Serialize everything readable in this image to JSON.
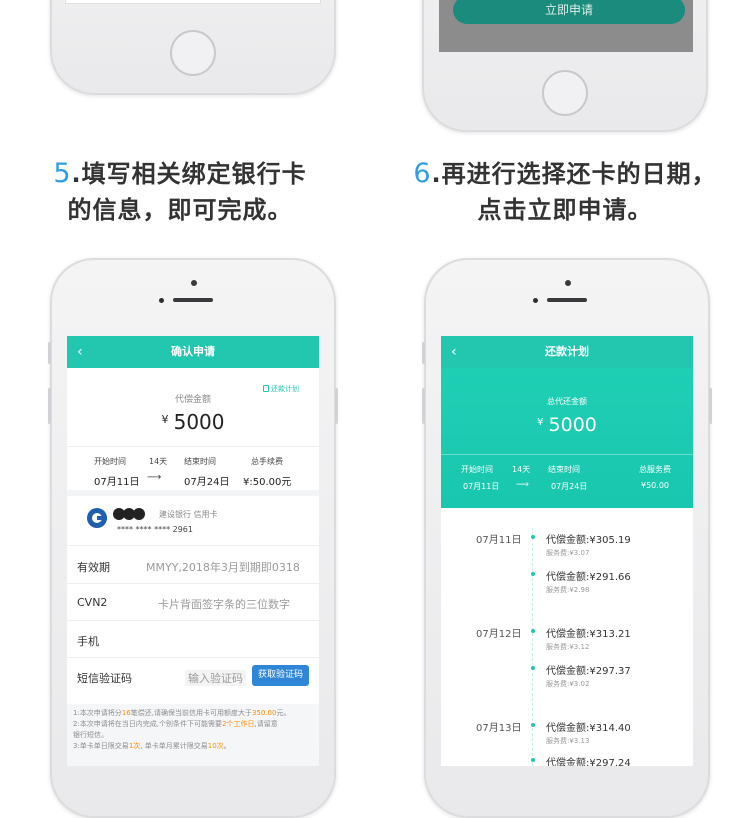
{
  "top_right_screen": {
    "apply_button": "立即申请"
  },
  "captions": {
    "left": {
      "num": "5",
      "line1": ".填写相关绑定银行卡",
      "line2": "的信息，即可完成。"
    },
    "right": {
      "num": "6",
      "line1": ".再进行选择还卡的日期，",
      "line2": "点击立即申请。"
    }
  },
  "confirm_screen": {
    "back_icon": "‹",
    "title": "确认申请",
    "plan_link": "还款计划",
    "amount_label": "代偿金额",
    "currency": "¥",
    "amount": "5000",
    "start_label": "开始时间",
    "start_date": "07月11日",
    "days": "14天",
    "arrow": "⟶",
    "end_label": "结束时间",
    "end_date": "07月24日",
    "fee_label": "总手续费",
    "fee_value": "¥:50.00元",
    "bank_name": "建设银行  信用卡",
    "card_mask": "**** **** ****  2961",
    "fields": [
      {
        "label": "有效期",
        "placeholder": "MMYY,2018年3月到期即0318"
      },
      {
        "label": "CVN2",
        "placeholder": "卡片背面签字条的三位数字"
      },
      {
        "label": "手机",
        "placeholder": ""
      },
      {
        "label": "短信验证码",
        "placeholder": "输入验证码"
      }
    ],
    "get_code_button": "获取验证码",
    "notes": {
      "n1_a": "1:本次申请将分",
      "n1_b": "16",
      "n1_c": "笔偿还,请确保当前信用卡可用额度大于",
      "n1_d": "350.00",
      "n1_e": "元。",
      "n2_a": "2:本次申请将在当日内完成,个别条件下可能需要",
      "n2_b": "2个工作日",
      "n2_c": ",请留意",
      "n2_d": "银行短信。",
      "n3_a": "3:单卡单日限交易",
      "n3_b": "1次",
      "n3_c": ", 单卡单月累计限交易",
      "n3_d": "10次",
      "n3_e": "。"
    }
  },
  "plan_screen": {
    "back_icon": "‹",
    "title": "还款计划",
    "total_label": "总代还金额",
    "currency": "¥",
    "total": "5000",
    "start_label": "开始时间",
    "days": "14天",
    "end_label": "结束时间",
    "service_label": "总服务费",
    "start_date": "07月11日",
    "arrow": "⟶",
    "end_date": "07月24日",
    "service_value": "¥50.00",
    "timeline": [
      {
        "date": "07月11日",
        "entries": [
          {
            "amount": "代偿金额:¥305.19",
            "fee": "服务费:¥3.07"
          },
          {
            "amount": "代偿金额:¥291.66",
            "fee": "服务费:¥2.98"
          }
        ]
      },
      {
        "date": "07月12日",
        "entries": [
          {
            "amount": "代偿金额:¥313.21",
            "fee": "服务费:¥3.12"
          },
          {
            "amount": "代偿金额:¥297.37",
            "fee": "服务费:¥3.02"
          }
        ]
      },
      {
        "date": "07月13日",
        "entries": [
          {
            "amount": "代偿金额:¥314.40",
            "fee": "服务费:¥3.13"
          },
          {
            "amount": "代偿金额:¥297.24",
            "fee": ""
          }
        ]
      }
    ]
  },
  "colors": {
    "accent": "#23c7b0",
    "blue": "#2f9fe0",
    "button": "#2f86d6",
    "highlight": "#ff8a00"
  }
}
